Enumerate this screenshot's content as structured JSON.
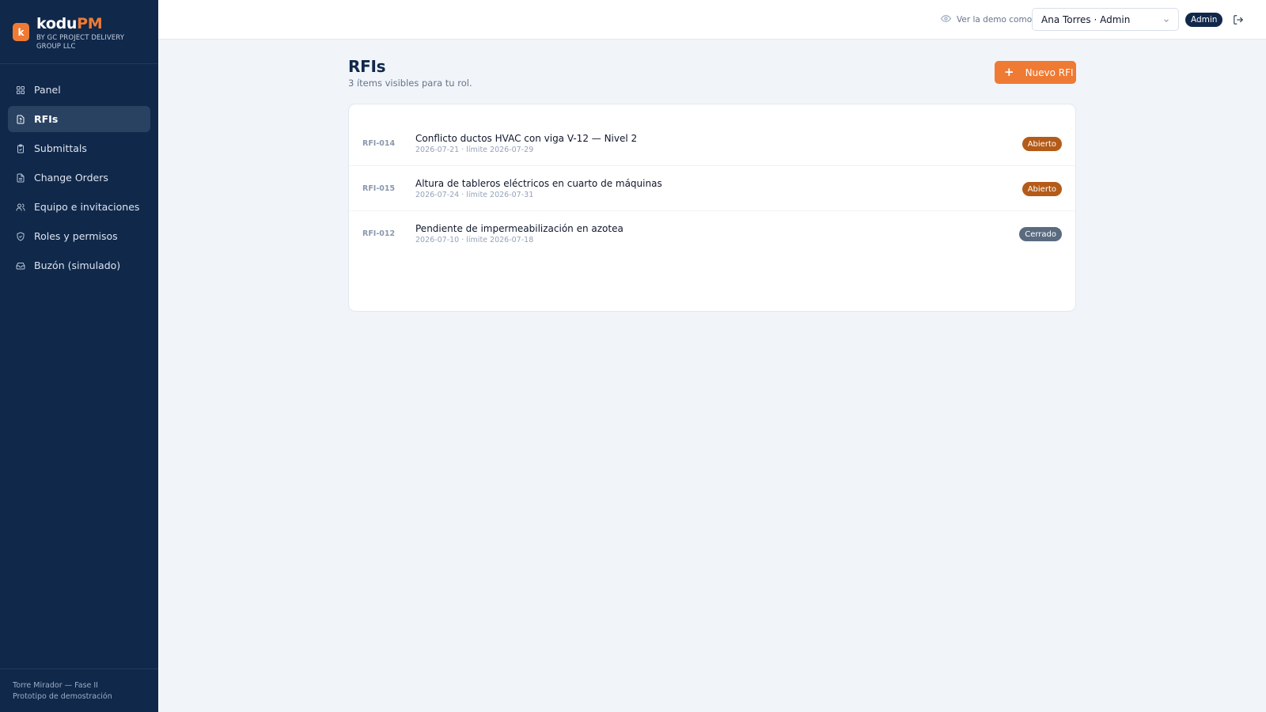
{
  "brand": {
    "logo_letter": "k",
    "name_part1": "kodu",
    "name_part2": "PM",
    "subtitle": "BY GC PROJECT DELIVERY GROUP LLC",
    "accent_color": "#ef7a33"
  },
  "sidebar": {
    "items": [
      {
        "label": "Panel",
        "icon": "grid-icon",
        "active": false
      },
      {
        "label": "RFIs",
        "icon": "document-question-icon",
        "active": true
      },
      {
        "label": "Submittals",
        "icon": "clipboard-check-icon",
        "active": false
      },
      {
        "label": "Change Orders",
        "icon": "file-text-icon",
        "active": false
      },
      {
        "label": "Equipo e invitaciones",
        "icon": "users-icon",
        "active": false
      },
      {
        "label": "Roles y permisos",
        "icon": "shield-check-icon",
        "active": false
      },
      {
        "label": "Buzón (simulado)",
        "icon": "inbox-icon",
        "active": false
      }
    ],
    "footer_project": "Torre Mirador — Fase II",
    "footer_note": "Prototipo de demostración"
  },
  "topbar": {
    "demo_label": "Ver la demo como:",
    "selected_user": "Ana Torres · Admin",
    "role_badge": "Admin"
  },
  "page": {
    "title": "RFIs",
    "subtitle": "3 ítems visibles para tu rol.",
    "new_button": "Nuevo RFI"
  },
  "rfis": [
    {
      "id": "RFI-014",
      "title": "Conflicto ductos HVAC con viga V-12 — Nivel 2",
      "meta": "2026-07-21 · límite 2026-07-29",
      "status": "Abierto"
    },
    {
      "id": "RFI-015",
      "title": "Altura de tableros eléctricos en cuarto de máquinas",
      "meta": "2026-07-24 · límite 2026-07-31",
      "status": "Abierto"
    },
    {
      "id": "RFI-012",
      "title": "Pendiente de impermeabilización en azotea",
      "meta": "2026-07-10 · límite 2026-07-18",
      "status": "Cerrado"
    }
  ]
}
